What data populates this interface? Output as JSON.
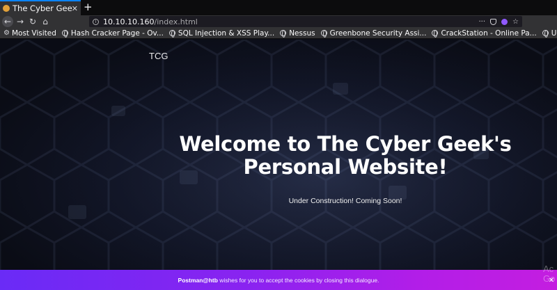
{
  "browser": {
    "tab_title": "The Cyber Geek's",
    "tab_close": "✕",
    "new_tab": "+",
    "url_host": "10.10.10.160",
    "url_path": "/index.html",
    "url_more": "···"
  },
  "bookmarks": [
    {
      "label": "Most Visited",
      "icon": "gear-icon"
    },
    {
      "label": "Hash Cracker Page - Ov...",
      "icon": "globe-icon"
    },
    {
      "label": "SQL Injection & XSS Play...",
      "icon": "globe-icon"
    },
    {
      "label": "Nessus",
      "icon": "globe-icon"
    },
    {
      "label": "Greenbone Security Assi...",
      "icon": "globe-icon"
    },
    {
      "label": "CrackStation - Online Pa...",
      "icon": "globe-icon"
    },
    {
      "label": "Upgrading shells to fully",
      "icon": "globe-icon"
    }
  ],
  "page": {
    "brand": "TCG",
    "headline_line1": "Welcome to The Cyber Geek's",
    "headline_line2": "Personal Website!",
    "subline": "Under Construction! Coming Soon!"
  },
  "cookie": {
    "brand": "Postman@htb",
    "message": " wishes for you to accept the cookies by closing this dialogue.",
    "close": "✕"
  },
  "overlay": {
    "activate_line1": "Ac",
    "activate_line2": "Go"
  },
  "colors": {
    "accent_tab": "#0a84ff",
    "banner_start": "#6a2bf6",
    "banner_end": "#c41ee0",
    "page_bg": "#111526"
  }
}
